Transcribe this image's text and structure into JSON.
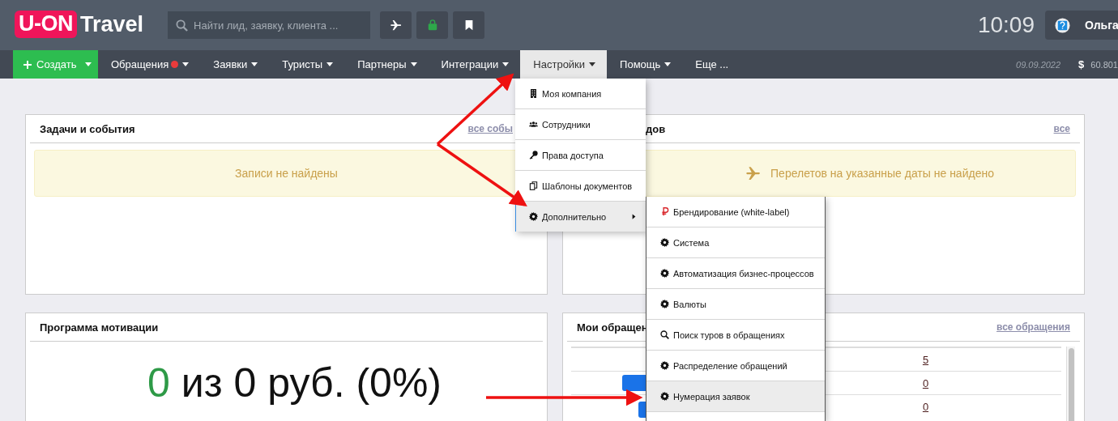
{
  "header": {
    "logo": {
      "badge": "U-ON",
      "text": "Travel"
    },
    "search": {
      "placeholder": "Найти лид, заявку, клиента ..."
    },
    "time": "10:09",
    "user": {
      "name": "Ольга"
    }
  },
  "nav": {
    "create": "Создать",
    "items": [
      {
        "label": "Обращения",
        "dot": true,
        "selected": false
      },
      {
        "label": "Заявки",
        "dot": false,
        "selected": false
      },
      {
        "label": "Туристы",
        "dot": false,
        "selected": false
      },
      {
        "label": "Партнеры",
        "dot": false,
        "selected": false
      },
      {
        "label": "Интеграции",
        "dot": false,
        "selected": false
      },
      {
        "label": "Настройки",
        "dot": false,
        "selected": true
      },
      {
        "label": "Помощь",
        "dot": false,
        "selected": false
      }
    ],
    "more": "Еще ...",
    "date": "09.09.2022",
    "currency_symbol": "$",
    "rate": "60.801"
  },
  "panels": [
    {
      "kind": "alert",
      "title": "Задачи и события",
      "link": "все собы",
      "message": "Записи не найдены"
    },
    {
      "kind": "flights",
      "title": "дов",
      "link": "все",
      "message": "Перелетов на указанные даты не найдено"
    },
    {
      "kind": "motivation",
      "title": "Программа мотивации",
      "value": "0",
      "rest": "из 0 руб. (0%)"
    },
    {
      "kind": "table",
      "title": "Мои обращен",
      "link": "все обращения",
      "rows": [
        "5",
        "0",
        "0"
      ]
    }
  ],
  "settings_menu": [
    {
      "label": "Моя компания",
      "selected": false
    },
    {
      "label": "Сотрудники",
      "selected": false
    },
    {
      "label": "Права доступа",
      "selected": false
    },
    {
      "label": "Шаблоны документов",
      "selected": false
    },
    {
      "label": "Дополнительно",
      "selected": true
    }
  ],
  "submenu": [
    {
      "label": "Брендирование (white-label)",
      "selected": false
    },
    {
      "label": "Система",
      "selected": false
    },
    {
      "label": "Автоматизация бизнес-процессов",
      "selected": false
    },
    {
      "label": "Валюты",
      "selected": false
    },
    {
      "label": "Поиск туров в обращениях",
      "selected": false
    },
    {
      "label": "Распределение обращений",
      "selected": false
    },
    {
      "label": "Нумерация заявок",
      "selected": true
    }
  ]
}
